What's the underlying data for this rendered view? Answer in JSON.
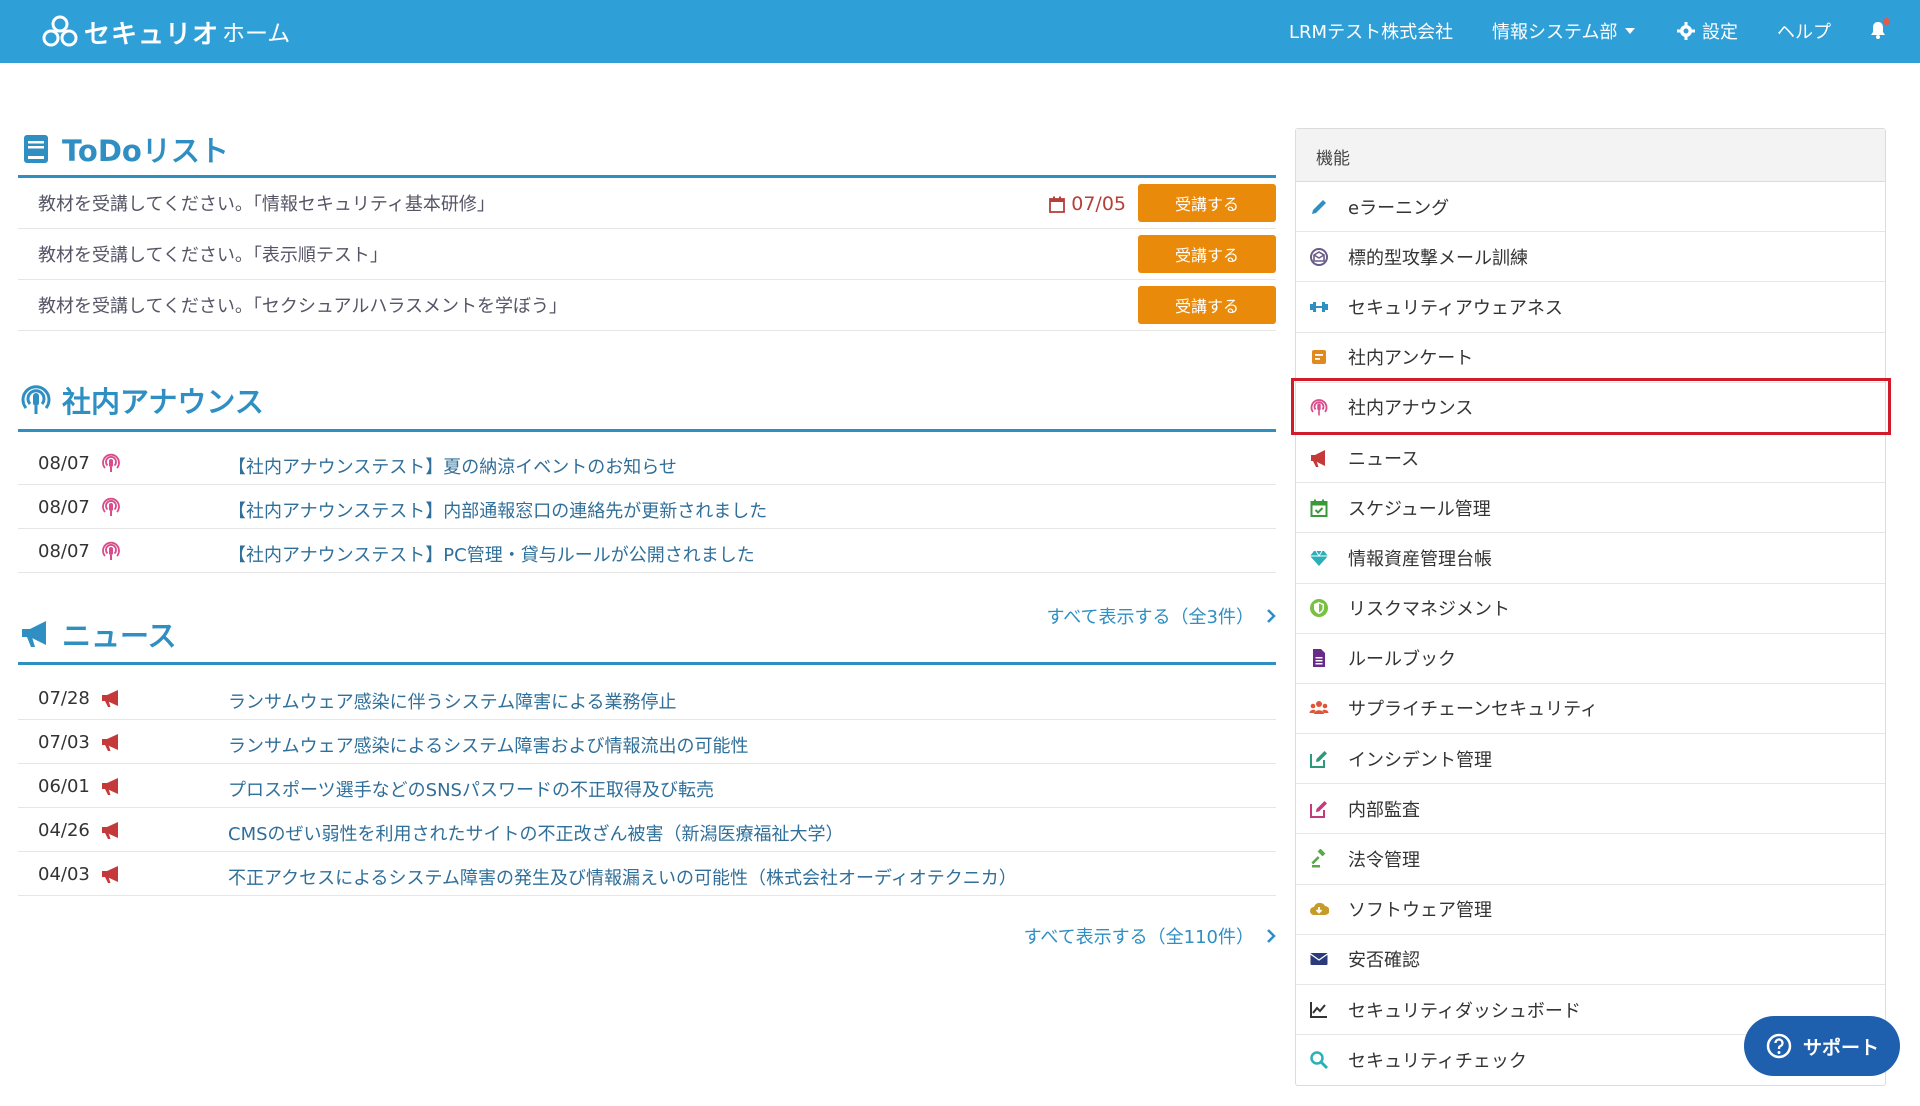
{
  "header": {
    "logo_text": "セキュリオ",
    "page_name": "ホーム",
    "company": "LRMテスト株式会社",
    "department": "情報システム部",
    "settings": "設定",
    "help": "ヘルプ"
  },
  "todo": {
    "title": "ToDoリスト",
    "items": [
      {
        "text": "教材を受講してください。「情報セキュリティ基本研修」",
        "due": "07/05",
        "button": "受講する"
      },
      {
        "text": "教材を受講してください。「表示順テスト」",
        "due": "",
        "button": "受講する"
      },
      {
        "text": "教材を受講してください。「セクシュアルハラスメントを学ぼう」",
        "due": "",
        "button": "受講する"
      }
    ]
  },
  "announce": {
    "title": "社内アナウンス",
    "items": [
      {
        "date": "08/07",
        "title": "【社内アナウンステスト】夏の納涼イベントのお知らせ"
      },
      {
        "date": "08/07",
        "title": "【社内アナウンステスト】内部通報窓口の連絡先が更新されました"
      },
      {
        "date": "08/07",
        "title": "【社内アナウンステスト】PC管理・貸与ルールが公開されました"
      }
    ],
    "show_all": "すべて表示する（全3件）"
  },
  "news": {
    "title": "ニュース",
    "items": [
      {
        "date": "07/28",
        "title": "ランサムウェア感染に伴うシステム障害による業務停止"
      },
      {
        "date": "07/03",
        "title": "ランサムウェア感染によるシステム障害および情報流出の可能性"
      },
      {
        "date": "06/01",
        "title": "プロスポーツ選手などのSNSパスワードの不正取得及び転売"
      },
      {
        "date": "04/26",
        "title": "CMSのぜい弱性を利用されたサイトの不正改ざん被害（新潟医療福祉大学）"
      },
      {
        "date": "04/03",
        "title": "不正アクセスによるシステム障害の発生及び情報漏えいの可能性（株式会社オーディオテクニカ）"
      }
    ],
    "show_all": "すべて表示する（全110件）"
  },
  "features": {
    "title": "機能",
    "items": [
      {
        "label": "eラーニング",
        "icon": "pencil-icon",
        "color": "#2f8fc2"
      },
      {
        "label": "標的型攻撃メール訓練",
        "icon": "mail-target-icon",
        "color": "#6a5a8a"
      },
      {
        "label": "セキュリティアウェアネス",
        "icon": "dumbbell-icon",
        "color": "#2f8fc2"
      },
      {
        "label": "社内アンケート",
        "icon": "survey-icon",
        "color": "#e08a1e"
      },
      {
        "label": "社内アナウンス",
        "icon": "podcast-icon",
        "color": "#d94b8a"
      },
      {
        "label": "ニュース",
        "icon": "megaphone-icon",
        "color": "#c43a3a"
      },
      {
        "label": "スケジュール管理",
        "icon": "calendar-check-icon",
        "color": "#3a9a3a"
      },
      {
        "label": "情報資産管理台帳",
        "icon": "diamond-icon",
        "color": "#2ab0b8"
      },
      {
        "label": "リスクマネジメント",
        "icon": "shield-icon",
        "color": "#7ac043"
      },
      {
        "label": "ルールブック",
        "icon": "document-icon",
        "color": "#6a2a8a"
      },
      {
        "label": "サプライチェーンセキュリティ",
        "icon": "users-icon",
        "color": "#e0553a"
      },
      {
        "label": "インシデント管理",
        "icon": "edit-icon",
        "color": "#2a9a7a"
      },
      {
        "label": "内部監査",
        "icon": "edit-icon",
        "color": "#c43a7a"
      },
      {
        "label": "法令管理",
        "icon": "gavel-icon",
        "color": "#5aa84a"
      },
      {
        "label": "ソフトウェア管理",
        "icon": "cloud-download-icon",
        "color": "#c79a2a"
      },
      {
        "label": "安否確認",
        "icon": "envelope-icon",
        "color": "#2a3a7a"
      },
      {
        "label": "セキュリティダッシュボード",
        "icon": "line-chart-icon",
        "color": "#333333"
      },
      {
        "label": "セキュリティチェック",
        "icon": "search-icon",
        "color": "#2ab0b8"
      }
    ]
  },
  "support": {
    "label": "サポート"
  }
}
